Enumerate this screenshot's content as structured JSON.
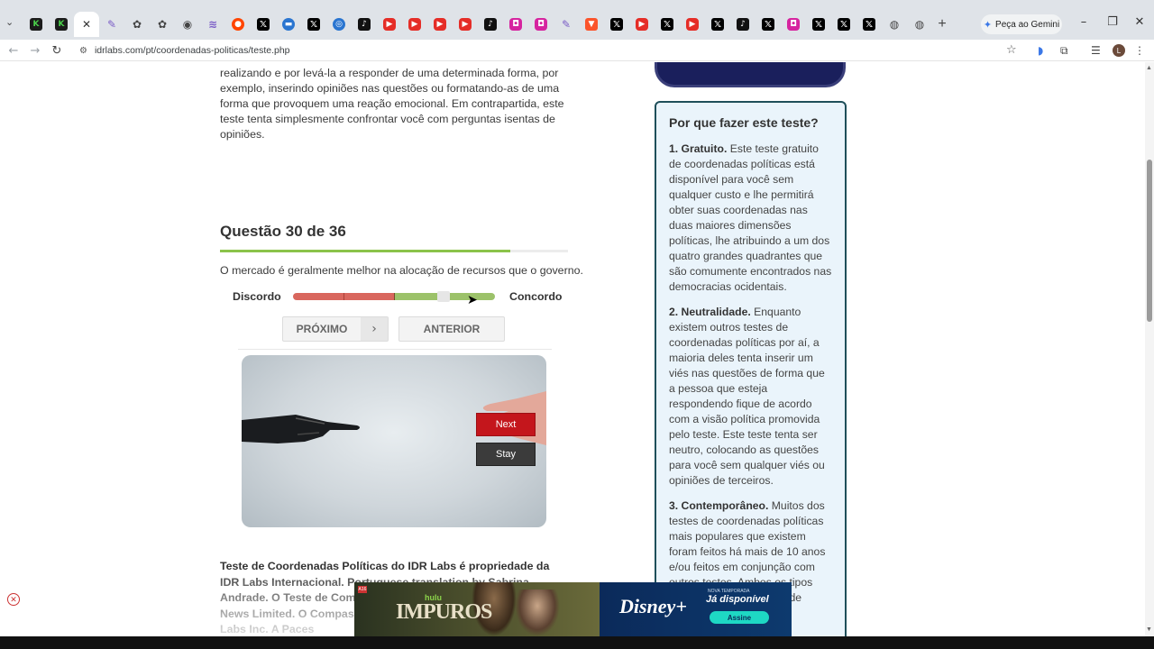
{
  "browser": {
    "tabs": [
      {
        "icon": "k-icon",
        "glyph": "K",
        "cls": "k"
      },
      {
        "icon": "k-icon",
        "glyph": "K",
        "cls": "k"
      },
      {
        "icon": "close-icon",
        "glyph": "✕",
        "cls": "close",
        "active": true
      },
      {
        "icon": "pen-icon",
        "glyph": "✎",
        "cls": "pen"
      },
      {
        "icon": "gpt-icon",
        "glyph": "✿",
        "cls": "gp"
      },
      {
        "icon": "gpt-icon",
        "glyph": "✿",
        "cls": "gp"
      },
      {
        "icon": "circle-icon",
        "glyph": "◉",
        "cls": "gp"
      },
      {
        "icon": "wave-icon",
        "glyph": "≋",
        "cls": "pen"
      },
      {
        "icon": "reddit-icon",
        "glyph": "●",
        "cls": "red"
      },
      {
        "icon": "x-icon",
        "glyph": "𝕏",
        "cls": "x"
      },
      {
        "icon": "mail-icon",
        "glyph": "▬",
        "cls": "blue"
      },
      {
        "icon": "x-icon",
        "glyph": "𝕏",
        "cls": "x"
      },
      {
        "icon": "blue-icon",
        "glyph": "◎",
        "cls": "blue"
      },
      {
        "icon": "tiktok-icon",
        "glyph": "♪",
        "cls": "tt"
      },
      {
        "icon": "youtube-icon",
        "glyph": "▶",
        "cls": "yt"
      },
      {
        "icon": "youtube-icon",
        "glyph": "▶",
        "cls": "yt"
      },
      {
        "icon": "youtube-icon",
        "glyph": "▶",
        "cls": "yt"
      },
      {
        "icon": "youtube-icon",
        "glyph": "▶",
        "cls": "yt"
      },
      {
        "icon": "tiktok-icon",
        "glyph": "♪",
        "cls": "tt"
      },
      {
        "icon": "instagram-icon",
        "glyph": "◘",
        "cls": "ig"
      },
      {
        "icon": "instagram-icon",
        "glyph": "◘",
        "cls": "ig"
      },
      {
        "icon": "pen-icon",
        "glyph": "✎",
        "cls": "pen"
      },
      {
        "icon": "brave-icon",
        "glyph": "▼",
        "cls": "brave"
      },
      {
        "icon": "x-icon",
        "glyph": "𝕏",
        "cls": "x"
      },
      {
        "icon": "youtube-icon",
        "glyph": "▶",
        "cls": "yt"
      },
      {
        "icon": "x-icon",
        "glyph": "𝕏",
        "cls": "x"
      },
      {
        "icon": "youtube-icon",
        "glyph": "▶",
        "cls": "yt"
      },
      {
        "icon": "x-icon",
        "glyph": "𝕏",
        "cls": "x"
      },
      {
        "icon": "tiktok-icon",
        "glyph": "♪",
        "cls": "tt"
      },
      {
        "icon": "x-icon",
        "glyph": "𝕏",
        "cls": "x"
      },
      {
        "icon": "instagram-icon",
        "glyph": "◘",
        "cls": "ig"
      },
      {
        "icon": "x-icon",
        "glyph": "𝕏",
        "cls": "x"
      },
      {
        "icon": "x-icon",
        "glyph": "𝕏",
        "cls": "x"
      },
      {
        "icon": "x-icon",
        "glyph": "𝕏",
        "cls": "x"
      },
      {
        "icon": "chrome-icon",
        "glyph": "◍",
        "cls": "gp"
      },
      {
        "icon": "chrome-icon",
        "glyph": "◍",
        "cls": "gp"
      }
    ],
    "new_tab": "+",
    "gemini_label": "Peça ao Gemini",
    "url": "idrlabs.com/pt/coordenadas-politicas/teste.php"
  },
  "content": {
    "intro": "realizando e por levá-la a responder de uma determinada forma, por exemplo, inserindo opiniões nas questões ou formatando-as de uma forma que provoquem uma reação emocional. Em contrapartida, este teste tenta simplesmente confrontar você com perguntas isentas de opiniões.",
    "question_title": "Questão 30 de 36",
    "question_progress": 0.833,
    "question_text": "O mercado é geralmente melhor na alocação de recursos que o governo.",
    "label_disagree": "Discordo",
    "label_agree": "Concordo",
    "next_label": "PRÓXIMO",
    "prev_label": "ANTERIOR",
    "video_next": "Next",
    "video_stay": "Stay",
    "footer": "Teste de Coordenadas Políticas do IDR Labs é propriedade da IDR Labs Internacional. Portuguese translation by Sabrina Andrade. O Teste de Compasso Político é propriedade de Pace News Limited. O Compasso Político é propriedade de Vox Pop Labs Inc. A Paces"
  },
  "sidebar": {
    "title": "Por que fazer este teste?",
    "items": [
      {
        "head": "1. Gratuito.",
        "body": " Este teste gratuito de coordenadas políticas está disponível para você sem qualquer custo e lhe permitirá obter suas coordenadas nas duas maiores dimensões políticas, lhe atribuindo a um dos quatro grandes quadrantes que são comumente encontrados nas democracias ocidentais."
      },
      {
        "head": "2. Neutralidade.",
        "body": " Enquanto existem outros testes de coordenadas políticas por aí, a maioria deles tenta inserir um viés nas questões de forma que a pessoa que esteja respondendo fique de acordo com a visão política promovida pelo teste. Este teste tenta ser neutro, colocando as questões para você sem qualquer viés ou opiniões de terceiros."
      },
      {
        "head": "3. Contemporâneo.",
        "body": " Muitos dos testes de coordenadas políticas mais populares que existem foram feitos há mais de 10 anos e/ou feitos em conjunção com outros testes. Ambos os tipos tendem a girar em torno de temas que foram"
      }
    ]
  },
  "banner": {
    "hulu": "hulu",
    "title": "IMPUROS",
    "brand": "Disney+",
    "season": "NOVA TEMPORADA",
    "available": "Já disponível",
    "cta": "Assine",
    "badge": "A16"
  }
}
